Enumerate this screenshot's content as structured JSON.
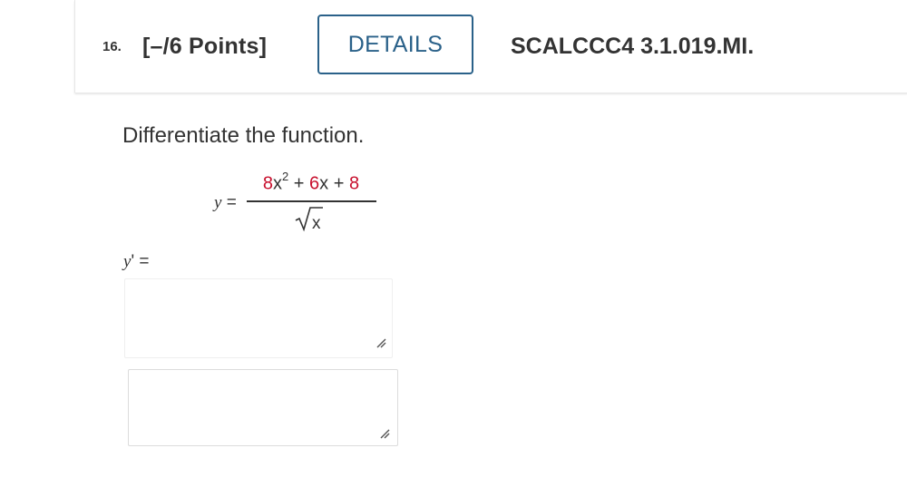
{
  "question": {
    "number": "16.",
    "points": "[–/6 Points]",
    "details_label": "DETAILS",
    "code": "SCALCCC4 3.1.019.MI."
  },
  "problem": {
    "instruction": "Differentiate the function.",
    "lhs_var": "y",
    "lhs_eq": " =",
    "numerator": {
      "coef1": "8",
      "var1": "x",
      "exp1": "2",
      "op1": " + ",
      "coef2": "6",
      "var2": "x",
      "op2": " + ",
      "const": "8"
    },
    "denominator_var": "x"
  },
  "answer": {
    "label_var": "y",
    "label_prime": "'",
    "label_eq": " =",
    "box1_value": "",
    "box2_value": ""
  },
  "colors": {
    "accent": "#2a6189",
    "highlight": "#c8102e",
    "text": "#333333"
  },
  "icons": [
    "resize-handle-icon",
    "square-root-symbol"
  ]
}
